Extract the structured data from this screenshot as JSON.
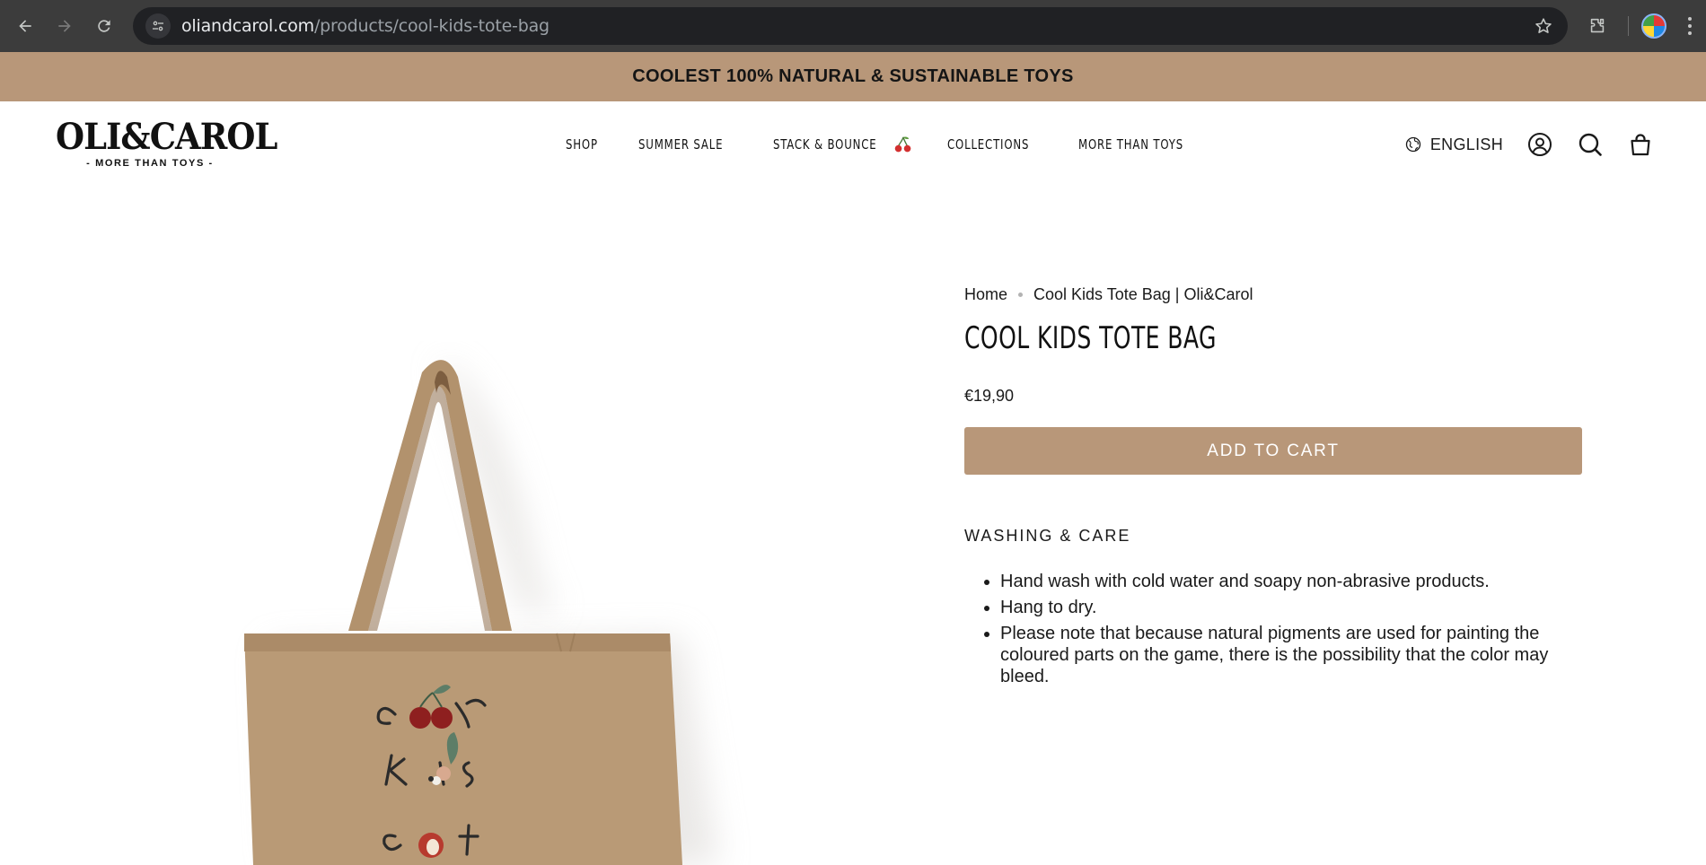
{
  "browser": {
    "url_host": "oliandcarol.com",
    "url_path": "/products/cool-kids-tote-bag"
  },
  "announcement": "COOLEST 100% NATURAL & SUSTAINABLE TOYS",
  "logo": {
    "wordmark": "OLI&CAROL",
    "tagline": "- MORE THAN TOYS -"
  },
  "nav": {
    "items": [
      "SHOP",
      "SUMMER SALE",
      "STACK & BOUNCE",
      "COLLECTIONS",
      "MORE THAN TOYS"
    ]
  },
  "header": {
    "language": "ENGLISH"
  },
  "product": {
    "breadcrumb_home": "Home",
    "breadcrumb_current": "Cool Kids Tote Bag | Oli&Carol",
    "title": "COOL KIDS TOTE BAG",
    "price": "€19,90",
    "add_to_cart": "ADD TO CART",
    "care_title": "WASHING & CARE",
    "care_items": [
      "Hand wash with cold water and soapy non-abrasive products.",
      "Hang to dry.",
      "Please note that because natural pigments are used for painting the coloured parts on the game, there is the possibility that the color may bleed."
    ]
  },
  "colors": {
    "accent": "#b89779",
    "chrome_bg": "#3c3c3c",
    "omnibox_bg": "#202124"
  }
}
